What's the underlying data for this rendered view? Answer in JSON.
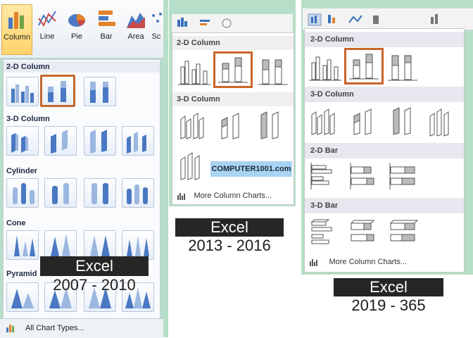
{
  "panel_2007": {
    "ribbon": [
      {
        "label": "Column",
        "icon": "column-chart-icon"
      },
      {
        "label": "Line",
        "icon": "line-chart-icon"
      },
      {
        "label": "Pie",
        "icon": "pie-chart-icon"
      },
      {
        "label": "Bar",
        "icon": "bar-chart-icon"
      },
      {
        "label": "Area",
        "icon": "area-chart-icon"
      },
      {
        "label": "Sc",
        "icon": "scatter-chart-icon"
      }
    ],
    "sections": [
      "2-D Column",
      "3-D Column",
      "Cylinder",
      "Cone",
      "Pyramid"
    ],
    "footer_link": "All Chart Types...",
    "caption": "Excel",
    "years": "2007 - 2010"
  },
  "panel_2013": {
    "sections": [
      "2-D Column",
      "3-D Column"
    ],
    "watermark": "COMPUTER1001.com",
    "footer_link": "More Column Charts...",
    "caption": "Excel",
    "years": "2013 - 2016"
  },
  "panel_2019": {
    "sections": [
      "2-D Column",
      "3-D Column",
      "2-D Bar",
      "3-D Bar"
    ],
    "footer_link": "More Column Charts...",
    "caption": "Excel",
    "years": "2019 - 365"
  },
  "colors": {
    "accent_selection": "#c8652a",
    "backdrop": "#b7dec8",
    "caption_bg": "#262626"
  }
}
